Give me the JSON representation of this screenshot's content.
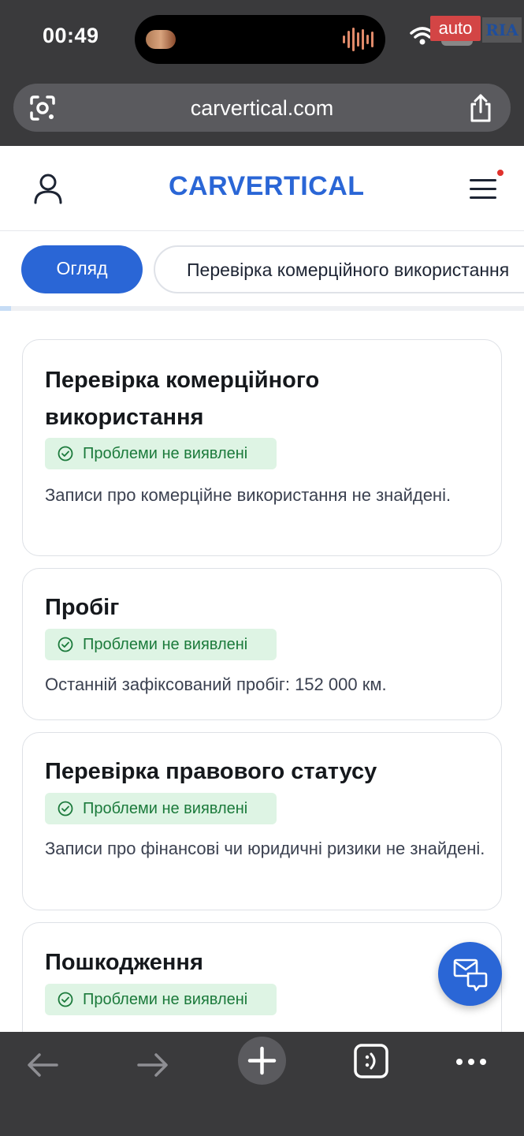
{
  "status_bar": {
    "time": "00:49",
    "battery": "24",
    "watermark_auto": "auto",
    "watermark_ria": "RIA"
  },
  "browser": {
    "url": "carvertical.com"
  },
  "site": {
    "logo": "CARVERTICAL",
    "accent_color": "#2a66d6"
  },
  "tabs": [
    {
      "label": "Огляд",
      "active": true
    },
    {
      "label": "Перевірка комерційного використання",
      "active": false
    }
  ],
  "cards": [
    {
      "title": "Перевірка комерційного використання",
      "badge": "Проблеми не виявлені",
      "text": "Записи про комерційне використання не знайдені."
    },
    {
      "title": "Пробіг",
      "badge": "Проблеми не виявлені",
      "text": "Останній зафіксований пробіг: 152 000 км."
    },
    {
      "title": "Перевірка правового статусу",
      "badge": "Проблеми не виявлені",
      "text": "Записи про фінансові чи юридичні ризики не знайдені."
    },
    {
      "title": "Пошкодження",
      "badge": "Проблеми не виявлені",
      "text": ""
    }
  ],
  "status_colors": {
    "ok_bg": "#def4e4",
    "ok_text": "#1b7a3b"
  }
}
